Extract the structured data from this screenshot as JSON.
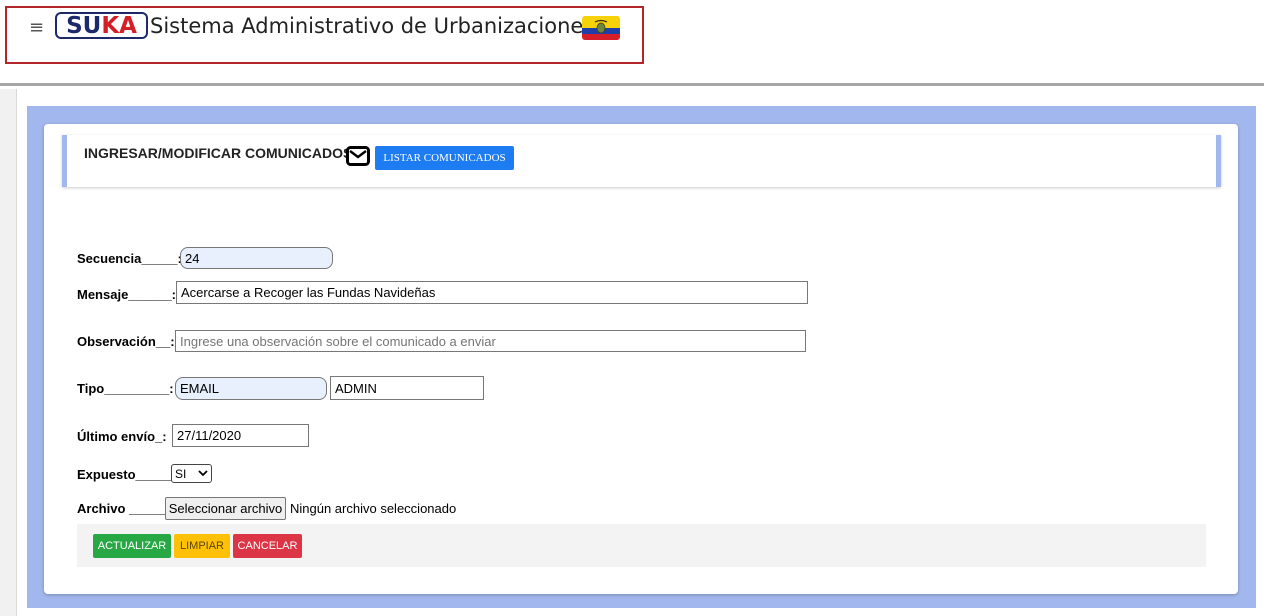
{
  "header": {
    "menu_glyph": "≡",
    "logo_part1": "SU",
    "logo_part2": "KA",
    "app_title": "Sistema Administrativo de Urbanizaciones",
    "flag_icon": "ecuador-flag-icon"
  },
  "panel": {
    "title": "INGRESAR/MODIFICAR COMUNICADOS",
    "mail_icon": "envelope-icon",
    "list_button": "LISTAR COMUNICADOS"
  },
  "form": {
    "secuencia": {
      "label": "Secuencia_____:",
      "value": "24"
    },
    "mensaje": {
      "label": "Mensaje______:",
      "value": "Acercarse a Recoger las Fundas Navideñas"
    },
    "observacion": {
      "label": "Observación__:",
      "value": "",
      "placeholder": "Ingrese una observación sobre el comunicado a enviar"
    },
    "tipo": {
      "label": "Tipo_________:",
      "value": "EMAIL",
      "value2": "ADMIN"
    },
    "ultimo_envio": {
      "label": "Último envío_:",
      "value": "27/11/2020"
    },
    "expuesto": {
      "label": "Expuesto_____:",
      "selected": "SI"
    },
    "archivo": {
      "label": "Archivo _____:",
      "button": "Seleccionar archivo",
      "status": "Ningún archivo seleccionado"
    }
  },
  "actions": {
    "update": "ACTUALIZAR",
    "clear": "LIMPIAR",
    "cancel": "CANCELAR"
  },
  "colors": {
    "page_background": "#a2b7ed",
    "brand_border": "#b3262c",
    "logo_blue": "#1c2a6b",
    "logo_red": "#d32027",
    "primary": "#1e7cf2",
    "success": "#28a745",
    "warning": "#ffc107",
    "danger": "#dc3545"
  }
}
